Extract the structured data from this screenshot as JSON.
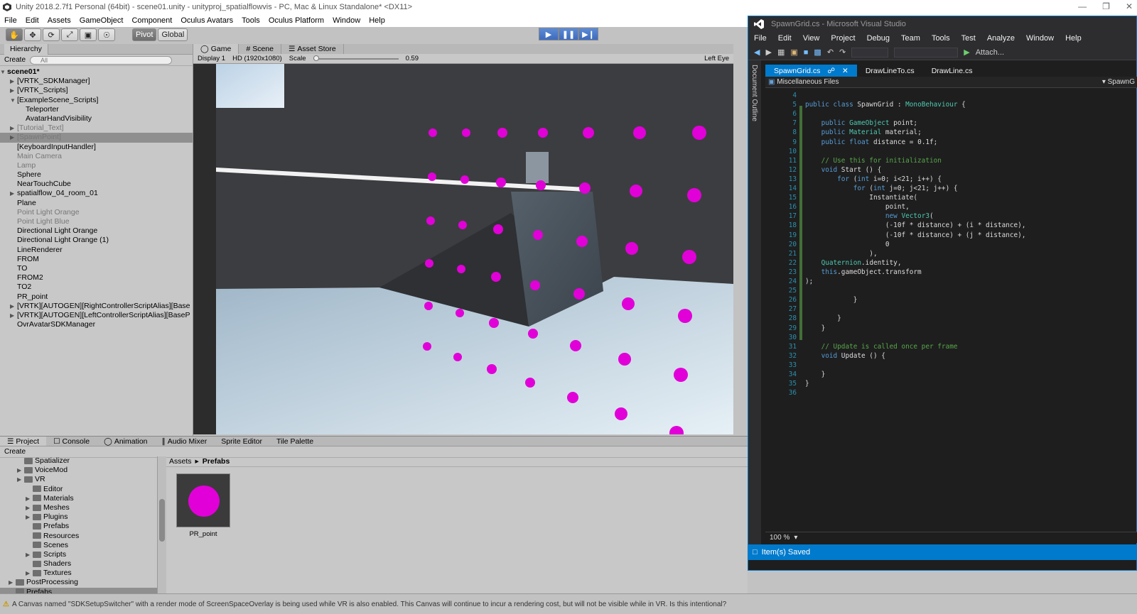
{
  "unity": {
    "title": "Unity 2018.2.7f1 Personal (64bit) - scene01.unity - unityproj_spatialflowvis - PC, Mac & Linux Standalone* <DX11>",
    "menu": [
      "File",
      "Edit",
      "Assets",
      "GameObject",
      "Component",
      "Oculus Avatars",
      "Tools",
      "Oculus Platform",
      "Window",
      "Help"
    ],
    "toolbar": {
      "pivot": "Pivot",
      "global": "Global"
    },
    "hierarchy": {
      "tab": "Hierarchy",
      "create": "Create",
      "search_placeholder": "All",
      "scene": "scene01*",
      "items": [
        {
          "label": "[VRTK_SDKManager]",
          "indent": 1,
          "arrow": true,
          "dim": false,
          "sel": false
        },
        {
          "label": "[VRTK_Scripts]",
          "indent": 1,
          "arrow": true,
          "dim": false,
          "sel": false
        },
        {
          "label": "[ExampleScene_Scripts]",
          "indent": 1,
          "arrow": true,
          "open": true,
          "dim": false,
          "sel": false
        },
        {
          "label": "Teleporter",
          "indent": 2,
          "arrow": false,
          "dim": false,
          "sel": false
        },
        {
          "label": "AvatarHandVisibility",
          "indent": 2,
          "arrow": false,
          "dim": false,
          "sel": false
        },
        {
          "label": "[Tutorial_Text]",
          "indent": 1,
          "arrow": true,
          "dim": true,
          "sel": false
        },
        {
          "label": "[SpawnPoint]",
          "indent": 1,
          "arrow": true,
          "dim": true,
          "sel": true
        },
        {
          "label": "[KeyboardInputHandler]",
          "indent": 1,
          "arrow": false,
          "dim": false,
          "sel": false
        },
        {
          "label": "Main Camera",
          "indent": 1,
          "arrow": false,
          "dim": true,
          "sel": false
        },
        {
          "label": "Lamp",
          "indent": 1,
          "arrow": false,
          "dim": true,
          "sel": false
        },
        {
          "label": "Sphere",
          "indent": 1,
          "arrow": false,
          "dim": false,
          "sel": false
        },
        {
          "label": "NearTouchCube",
          "indent": 1,
          "arrow": false,
          "dim": false,
          "sel": false
        },
        {
          "label": "spatialflow_04_room_01",
          "indent": 1,
          "arrow": true,
          "dim": false,
          "sel": false
        },
        {
          "label": "Plane",
          "indent": 1,
          "arrow": false,
          "dim": false,
          "sel": false
        },
        {
          "label": "Point Light Orange",
          "indent": 1,
          "arrow": false,
          "dim": true,
          "sel": false
        },
        {
          "label": "Point Light Blue",
          "indent": 1,
          "arrow": false,
          "dim": true,
          "sel": false
        },
        {
          "label": "Directional Light Orange",
          "indent": 1,
          "arrow": false,
          "dim": false,
          "sel": false
        },
        {
          "label": "Directional Light Orange (1)",
          "indent": 1,
          "arrow": false,
          "dim": false,
          "sel": false
        },
        {
          "label": "LineRenderer",
          "indent": 1,
          "arrow": false,
          "dim": false,
          "sel": false
        },
        {
          "label": "FROM",
          "indent": 1,
          "arrow": false,
          "dim": false,
          "sel": false
        },
        {
          "label": "TO",
          "indent": 1,
          "arrow": false,
          "dim": false,
          "sel": false
        },
        {
          "label": "FROM2",
          "indent": 1,
          "arrow": false,
          "dim": false,
          "sel": false
        },
        {
          "label": "TO2",
          "indent": 1,
          "arrow": false,
          "dim": false,
          "sel": false
        },
        {
          "label": "PR_point",
          "indent": 1,
          "arrow": false,
          "dim": false,
          "sel": false
        },
        {
          "label": "[VRTK][AUTOGEN][RightControllerScriptAlias][Base",
          "indent": 1,
          "arrow": true,
          "dim": false,
          "sel": false
        },
        {
          "label": "[VRTK][AUTOGEN][LeftControllerScriptAlias][BaseP",
          "indent": 1,
          "arrow": true,
          "dim": false,
          "sel": false
        },
        {
          "label": "OvrAvatarSDKManager",
          "indent": 1,
          "arrow": false,
          "dim": false,
          "sel": false
        }
      ]
    },
    "game": {
      "tabs": [
        "Game",
        "Scene",
        "Asset Store"
      ],
      "display": "Display 1",
      "resolution": "HD (1920x1080)",
      "scale_label": "Scale",
      "scale_value": "0.59",
      "eye": "Left Eye"
    },
    "project": {
      "tabs": [
        "Project",
        "Console",
        "Animation",
        "Audio Mixer",
        "Sprite Editor",
        "Tile Palette"
      ],
      "create": "Create",
      "folders": [
        {
          "label": "Spatializer",
          "indent": 2,
          "arrow": false
        },
        {
          "label": "VoiceMod",
          "indent": 2,
          "arrow": true
        },
        {
          "label": "VR",
          "indent": 2,
          "arrow": true
        },
        {
          "label": "Editor",
          "indent": 3,
          "arrow": false
        },
        {
          "label": "Materials",
          "indent": 3,
          "arrow": true
        },
        {
          "label": "Meshes",
          "indent": 3,
          "arrow": true
        },
        {
          "label": "Plugins",
          "indent": 3,
          "arrow": true
        },
        {
          "label": "Prefabs",
          "indent": 3,
          "arrow": false
        },
        {
          "label": "Resources",
          "indent": 3,
          "arrow": false
        },
        {
          "label": "Scenes",
          "indent": 3,
          "arrow": false
        },
        {
          "label": "Scripts",
          "indent": 3,
          "arrow": true
        },
        {
          "label": "Shaders",
          "indent": 3,
          "arrow": false
        },
        {
          "label": "Textures",
          "indent": 3,
          "arrow": true
        },
        {
          "label": "PostProcessing",
          "indent": 1,
          "arrow": true
        },
        {
          "label": "Prefabs",
          "indent": 1,
          "arrow": false
        }
      ],
      "breadcrumb": [
        "Assets",
        "Prefabs"
      ],
      "asset": "PR_point"
    },
    "status": "A Canvas named \"SDKSetupSwitcher\" with a render mode of ScreenSpaceOverlay is being used while VR is also enabled. This Canvas will continue to incur a rendering cost, but will not be visible while in VR. Is this intentional?"
  },
  "vs": {
    "title": "SpawnGrid.cs - Microsoft Visual Studio",
    "menu": [
      "File",
      "Edit",
      "View",
      "Project",
      "Debug",
      "Team",
      "Tools",
      "Test",
      "Analyze",
      "Window",
      "Help"
    ],
    "attach": "Attach...",
    "doc_outline": "Document Outline",
    "tabs": [
      "SpawnGrid.cs",
      "DrawLineTo.cs",
      "DrawLine.cs"
    ],
    "nav_left": "Miscellaneous Files",
    "nav_right": "SpawnG",
    "zoom": "100 %",
    "status": "Item(s) Saved",
    "lines": [
      {
        "n": "4",
        "code": ""
      },
      {
        "n": "5",
        "code": "public class SpawnGrid : MonoBehaviour {"
      },
      {
        "n": "6",
        "code": ""
      },
      {
        "n": "7",
        "code": "    public GameObject point;"
      },
      {
        "n": "8",
        "code": "    public Material material;"
      },
      {
        "n": "9",
        "code": "    public float distance = 0.1f;"
      },
      {
        "n": "10",
        "code": ""
      },
      {
        "n": "11",
        "code": "    // Use this for initialization"
      },
      {
        "n": "12",
        "code": "    void Start () {"
      },
      {
        "n": "13",
        "code": "        for (int i=0; i<21; i++) {"
      },
      {
        "n": "14",
        "code": "            for (int j=0; j<21; j++) {"
      },
      {
        "n": "15",
        "code": "                Instantiate("
      },
      {
        "n": "16",
        "code": "                    point,"
      },
      {
        "n": "17",
        "code": "                    new Vector3("
      },
      {
        "n": "18",
        "code": "                    (-10f * distance) + (i * distance),"
      },
      {
        "n": "19",
        "code": "                    (-10f * distance) + (j * distance),"
      },
      {
        "n": "20",
        "code": "                    0"
      },
      {
        "n": "21",
        "code": "                ),"
      },
      {
        "n": "22",
        "code": "    Quaternion.identity,"
      },
      {
        "n": "23",
        "code": "    this.gameObject.transform"
      },
      {
        "n": "24",
        "code": ");"
      },
      {
        "n": "25",
        "code": ""
      },
      {
        "n": "26",
        "code": "            }"
      },
      {
        "n": "27",
        "code": ""
      },
      {
        "n": "28",
        "code": "        }"
      },
      {
        "n": "29",
        "code": "    }"
      },
      {
        "n": "30",
        "code": ""
      },
      {
        "n": "31",
        "code": "    // Update is called once per frame"
      },
      {
        "n": "32",
        "code": "    void Update () {"
      },
      {
        "n": "33",
        "code": ""
      },
      {
        "n": "34",
        "code": "    }"
      },
      {
        "n": "35",
        "code": "}"
      },
      {
        "n": "36",
        "code": ""
      }
    ]
  },
  "colors": {
    "accent": "#007acc",
    "point": "#e100d8"
  }
}
